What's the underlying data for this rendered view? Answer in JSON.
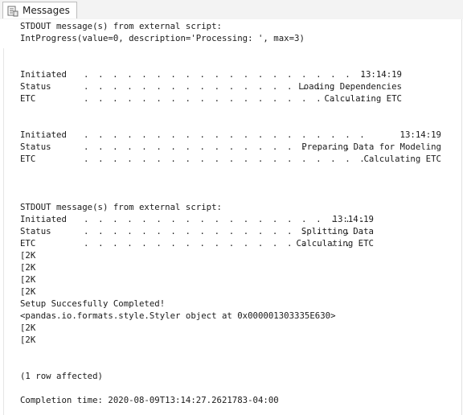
{
  "tab": {
    "label": "Messages",
    "icon": "messages-icon"
  },
  "output": {
    "header_1": "STDOUT message(s) from external script:",
    "header_2": "IntProgress(value=0, description='Processing: ', max=3)",
    "block1": {
      "initiated_label": "Initiated",
      "initiated_value": "13:14:19",
      "status_label": "Status",
      "status_value": "Loading Dependencies",
      "etc_label": "ETC",
      "etc_value": "Calculating ETC"
    },
    "block2": {
      "initiated_label": "Initiated",
      "initiated_value": "13:14:19",
      "status_label": "Status",
      "status_value": "Preparing Data for Modeling",
      "etc_label": "ETC",
      "etc_value": "Calculating ETC"
    },
    "header_3": "STDOUT message(s) from external script:",
    "block3": {
      "initiated_label": "Initiated",
      "initiated_value": "13:14:19",
      "status_label": "Status",
      "status_value": "Splitting Data",
      "etc_label": "ETC",
      "etc_value": "Calculating ETC"
    },
    "esc_1": "[2K",
    "esc_2": "[2K",
    "esc_3": "[2K",
    "esc_4": "[2K",
    "setup_complete": "Setup Succesfully Completed!",
    "styler": "<pandas.io.formats.style.Styler object at 0x000001303335E630>",
    "esc_5": "[2K",
    "esc_6": "[2K",
    "rows_affected": "(1 row affected)",
    "completion_time": "Completion time: 2020-08-09T13:14:27.2621783-04:00",
    "dot_leader": ". . . . . . . . . . . . . . . . . . . ."
  }
}
